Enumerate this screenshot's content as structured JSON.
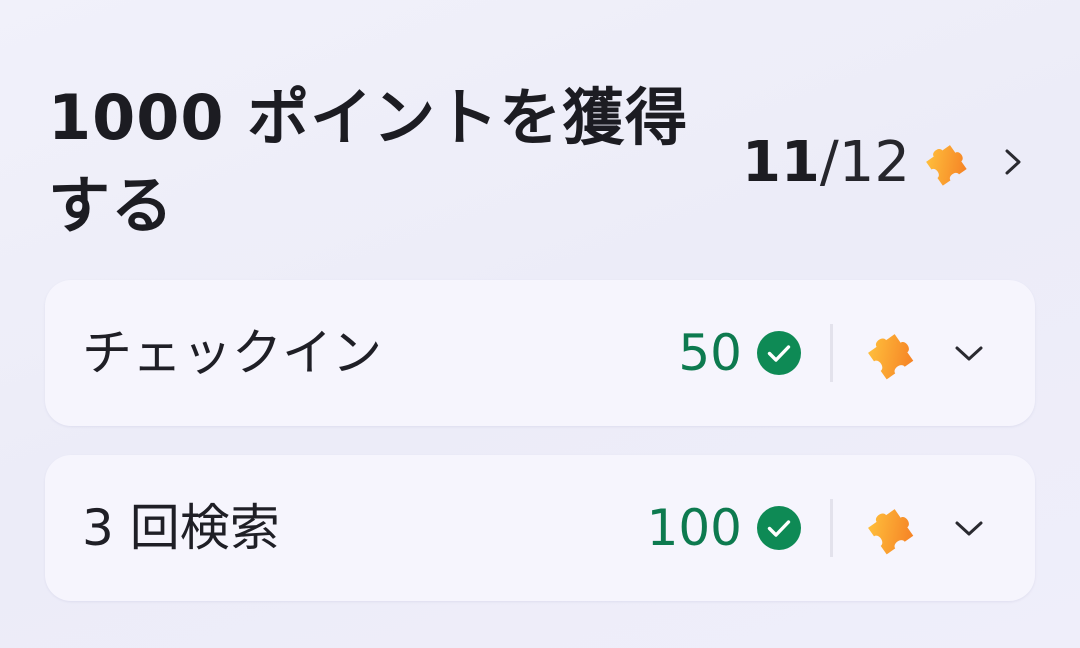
{
  "header": {
    "title_line1": "1000 ポイントを獲得",
    "title_line2": "する",
    "progress_current": "11",
    "progress_total": "/12",
    "puzzle_icon": "puzzle-icon",
    "chevron_icon": "chevron-right-icon"
  },
  "tasks": [
    {
      "label": "チェックイン",
      "points": "50",
      "status": "completed",
      "status_icon": "check-circle-icon",
      "reward_icon": "puzzle-icon",
      "expand_icon": "chevron-down-icon"
    },
    {
      "label": "3 回検索",
      "points": "100",
      "status": "completed",
      "status_icon": "check-circle-icon",
      "reward_icon": "puzzle-icon",
      "expand_icon": "chevron-down-icon"
    }
  ],
  "colors": {
    "points_green": "#0d7a4f",
    "check_green": "#0e8a55",
    "puzzle_orange": "#f7932d",
    "puzzle_yellow": "#ffc040",
    "card_bg": "#f6f5fd",
    "page_bg": "#efeefa"
  }
}
